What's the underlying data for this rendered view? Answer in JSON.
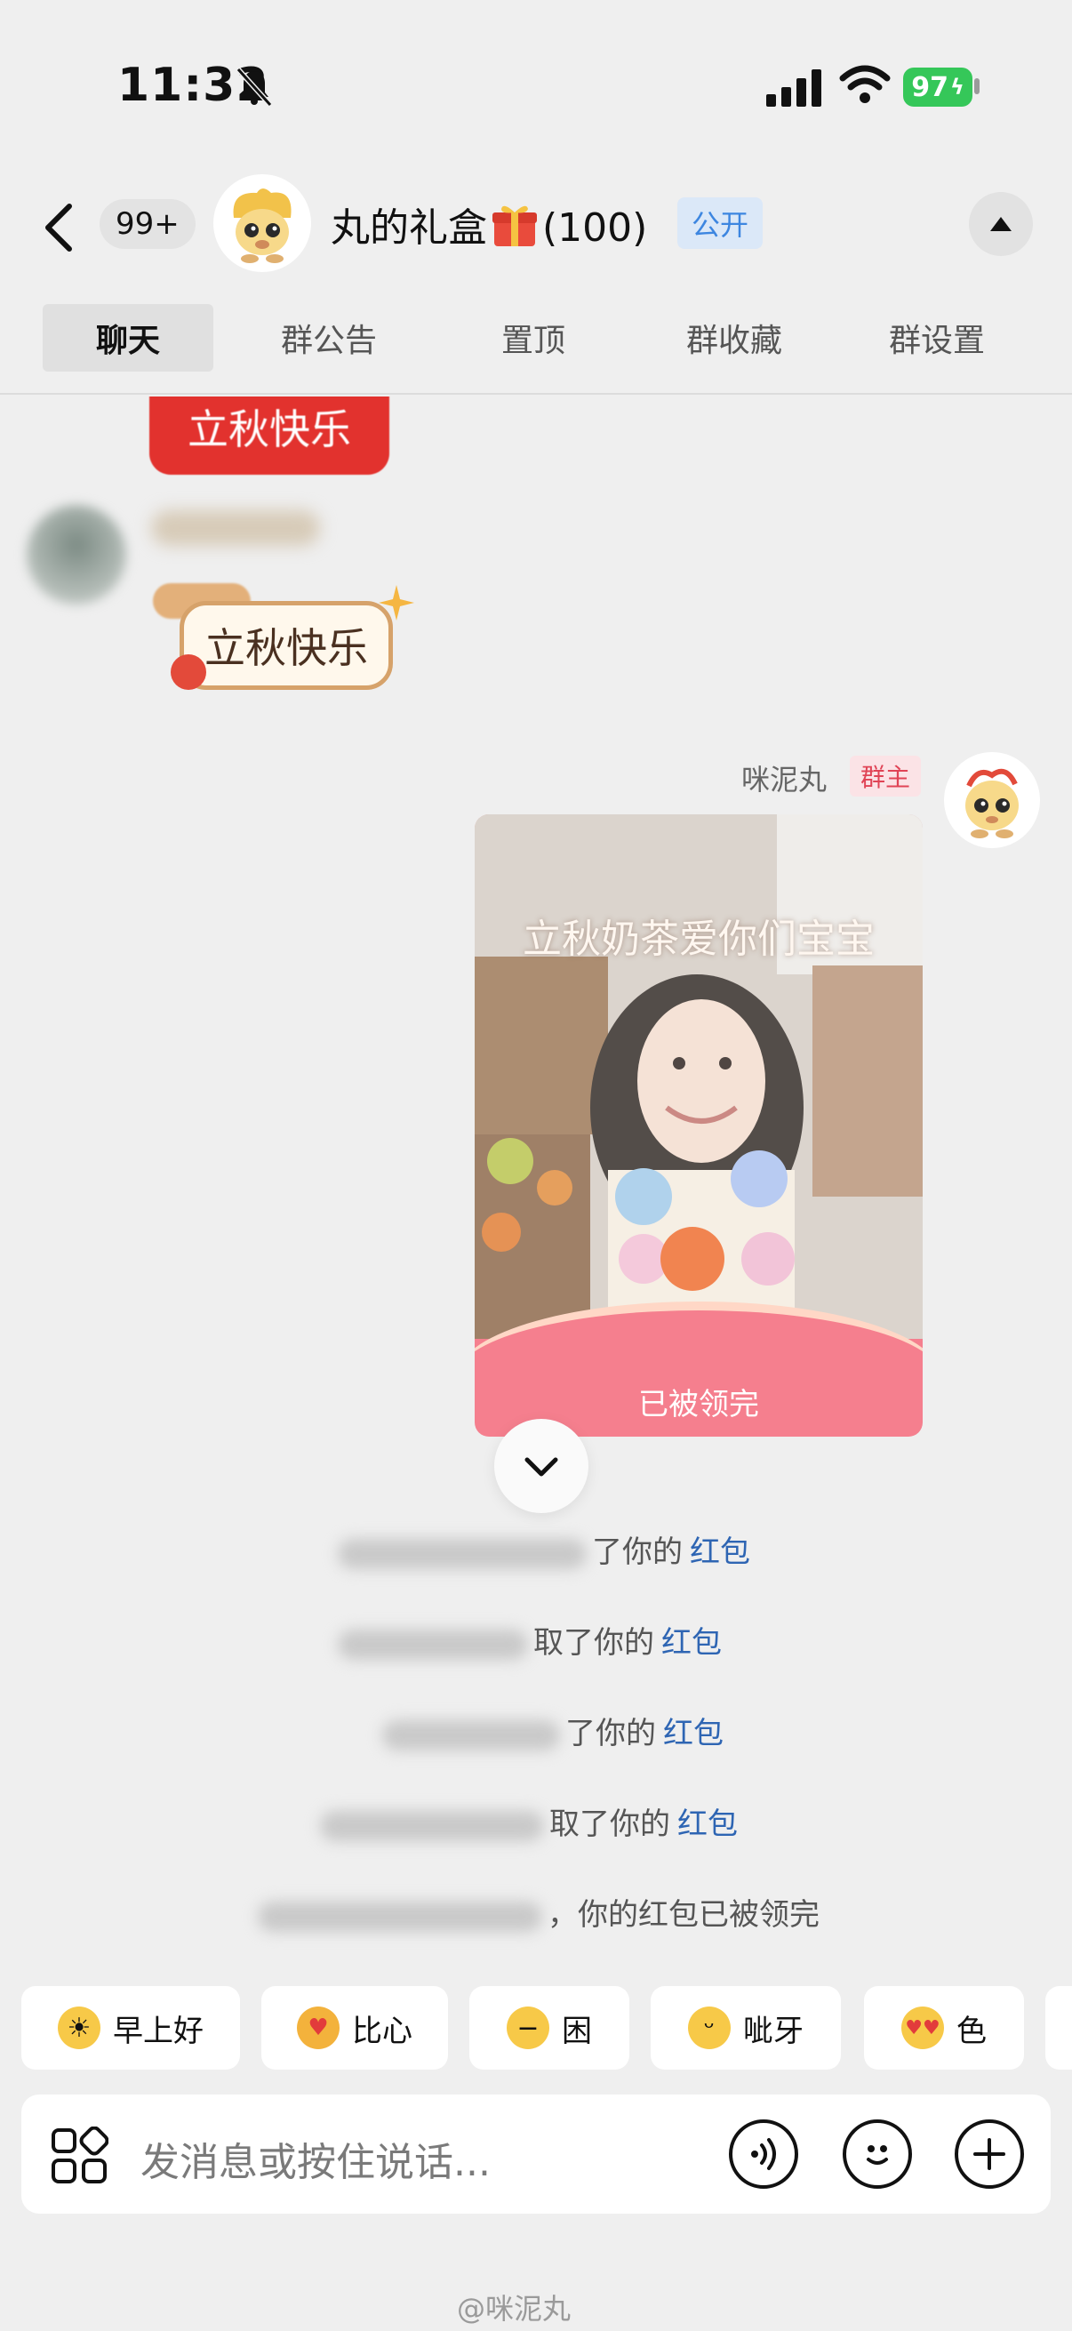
{
  "status_bar": {
    "time": "11:32",
    "battery": "97"
  },
  "header": {
    "unread_count": "99+",
    "group_name": "丸的礼盒",
    "member_count": "(100)",
    "visibility_tag": "公开"
  },
  "tabs": [
    {
      "label": "聊天",
      "active": true
    },
    {
      "label": "群公告",
      "active": false
    },
    {
      "label": "置顶",
      "active": false
    },
    {
      "label": "群收藏",
      "active": false
    },
    {
      "label": "群设置",
      "active": false
    }
  ],
  "messages": {
    "sticker_top_text": "立秋快乐",
    "sticker_second_text": "立秋快乐",
    "sender_name": "咪泥丸",
    "sender_role": "群主",
    "red_packet": {
      "caption": "立秋奶茶爱你们宝宝",
      "status": "已被领完"
    },
    "system": [
      {
        "text": "了你的",
        "link": "红包"
      },
      {
        "text": "取了你的",
        "link": "红包"
      },
      {
        "text": "了你的",
        "link": "红包"
      },
      {
        "text": "取了你的",
        "link": "红包"
      },
      {
        "text": "，你的红包已被领完",
        "link": ""
      }
    ]
  },
  "quick_replies": [
    {
      "label": "早上好",
      "icon": "sun-emoji-icon"
    },
    {
      "label": "比心",
      "icon": "heart-hands-emoji-icon"
    },
    {
      "label": "困",
      "icon": "sleepy-emoji-icon"
    },
    {
      "label": "呲牙",
      "icon": "grin-emoji-icon"
    },
    {
      "label": "色",
      "icon": "heart-eyes-emoji-icon"
    }
  ],
  "input": {
    "placeholder": "发消息或按住说话..."
  },
  "watermark": "@咪泥丸",
  "colors": {
    "background": "#efefef",
    "link": "#2e65b3",
    "red_packet": "#f57f8e",
    "owner_tag": "#e04456",
    "public_tag": "#3d86e0",
    "battery": "#35c759"
  }
}
